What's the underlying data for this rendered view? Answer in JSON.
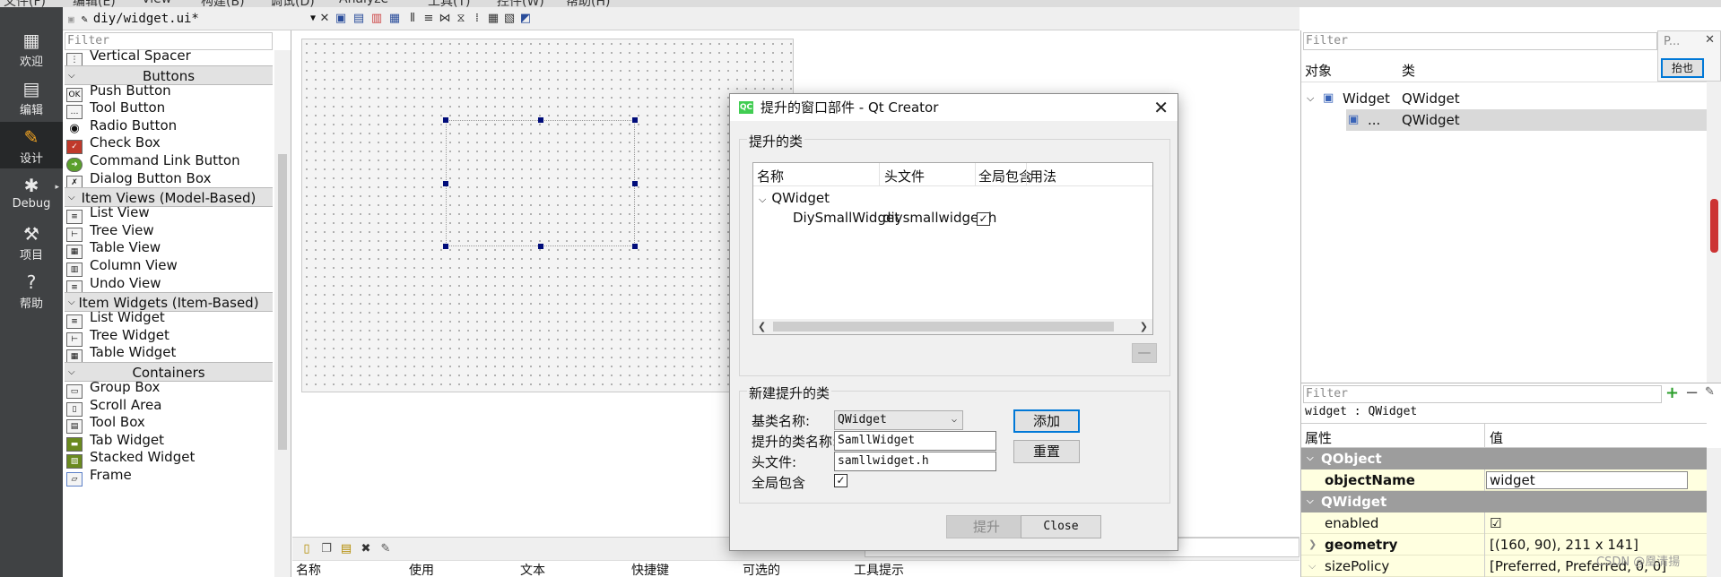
{
  "top_menu": [
    "文件(F)",
    "编辑(E)",
    "View",
    "构建(B)",
    "调试(D)",
    "Analyze",
    "工具(T)",
    "控件(W)",
    "帮助(H)"
  ],
  "mode_bar": {
    "items": [
      {
        "label": "欢迎",
        "icon": "grid-icon"
      },
      {
        "label": "编辑",
        "icon": "document-icon"
      },
      {
        "label": "设计",
        "icon": "pencil-icon",
        "active": true
      },
      {
        "label": "Debug",
        "icon": "bug-icon"
      },
      {
        "label": "项目",
        "icon": "wrench-icon"
      },
      {
        "label": "帮助",
        "icon": "help-icon"
      }
    ]
  },
  "editor_toolbar": {
    "file": "diy/widget.ui*"
  },
  "widget_box": {
    "filter_placeholder": "Filter",
    "items": [
      {
        "type": "item",
        "label": "Vertical Spacer",
        "icon": "vertical-spacer-icon"
      },
      {
        "type": "category",
        "label": "Buttons"
      },
      {
        "type": "item",
        "label": "Push Button",
        "icon": "push-button-icon"
      },
      {
        "type": "item",
        "label": "Tool Button",
        "icon": "tool-button-icon"
      },
      {
        "type": "item",
        "label": "Radio Button",
        "icon": "radio-button-icon"
      },
      {
        "type": "item",
        "label": "Check Box",
        "icon": "check-box-icon"
      },
      {
        "type": "item",
        "label": "Command Link Button",
        "icon": "command-link-icon"
      },
      {
        "type": "item",
        "label": "Dialog Button Box",
        "icon": "dialog-button-box-icon"
      },
      {
        "type": "category",
        "label": "Item Views (Model-Based)"
      },
      {
        "type": "item",
        "label": "List View",
        "icon": "list-view-icon"
      },
      {
        "type": "item",
        "label": "Tree View",
        "icon": "tree-view-icon"
      },
      {
        "type": "item",
        "label": "Table View",
        "icon": "table-view-icon"
      },
      {
        "type": "item",
        "label": "Column View",
        "icon": "column-view-icon"
      },
      {
        "type": "item",
        "label": "Undo View",
        "icon": "undo-view-icon"
      },
      {
        "type": "category",
        "label": "Item Widgets (Item-Based)"
      },
      {
        "type": "item",
        "label": "List Widget",
        "icon": "list-widget-icon"
      },
      {
        "type": "item",
        "label": "Tree Widget",
        "icon": "tree-widget-icon"
      },
      {
        "type": "item",
        "label": "Table Widget",
        "icon": "table-widget-icon"
      },
      {
        "type": "category",
        "label": "Containers"
      },
      {
        "type": "item",
        "label": "Group Box",
        "icon": "group-box-icon"
      },
      {
        "type": "item",
        "label": "Scroll Area",
        "icon": "scroll-area-icon"
      },
      {
        "type": "item",
        "label": "Tool Box",
        "icon": "tool-box-icon"
      },
      {
        "type": "item",
        "label": "Tab Widget",
        "icon": "tab-widget-icon"
      },
      {
        "type": "item",
        "label": "Stacked Widget",
        "icon": "stacked-widget-icon"
      },
      {
        "type": "item",
        "label": "Frame",
        "icon": "frame-icon"
      }
    ]
  },
  "action_editor": {
    "columns": [
      "名称",
      "使用",
      "文本",
      "快捷键",
      "可选的",
      "工具提示"
    ]
  },
  "object_inspector": {
    "filter_placeholder": "Filter",
    "col_object": "对象",
    "col_class": "类",
    "rows": [
      {
        "object": "Widget",
        "class": "QWidget"
      },
      {
        "object": "...",
        "class": "QWidget"
      }
    ]
  },
  "tiny_panel": {
    "title": "P...",
    "button": "抬也"
  },
  "property_editor": {
    "filter_placeholder": "Filter",
    "class_label": "widget : QWidget",
    "col_property": "属性",
    "col_value": "值",
    "groups": [
      {
        "name": "QObject",
        "rows": [
          {
            "name": "objectName",
            "value": "widget",
            "bold": true
          }
        ]
      },
      {
        "name": "QWidget",
        "rows": [
          {
            "name": "enabled",
            "value": "☑",
            "bold": false
          },
          {
            "name": "geometry",
            "value": "[(160, 90), 211 x 141]",
            "bold": true
          },
          {
            "name": "sizePolicy",
            "value": "[Preferred, Preferred, 0, 0]",
            "bold": false
          }
        ]
      }
    ]
  },
  "dialog": {
    "title": "提升的窗口部件 - Qt Creator",
    "icon_text": "QC",
    "promoted_group": "提升的类",
    "table_headers": [
      "名称",
      "头文件",
      "全局包含",
      "用法"
    ],
    "table_rows": [
      {
        "level": 0,
        "name": "QWidget",
        "header": "",
        "global": false
      },
      {
        "level": 1,
        "name": "DiySmallWidget",
        "header": "diysmallwidget.h",
        "global": true
      }
    ],
    "new_group": "新建提升的类",
    "base_class_label": "基类名称:",
    "base_class_value": "QWidget",
    "promoted_name_label": "提升的类名称:",
    "promoted_name_value": "SamllWidget",
    "header_label": "头文件:",
    "header_value": "samllwidget.h",
    "global_label": "全局包含",
    "global_checked": true,
    "add_button": "添加",
    "reset_button": "重置",
    "promote_button": "提升",
    "close_button": "Close"
  },
  "watermark": "CSDN @凰清揚"
}
